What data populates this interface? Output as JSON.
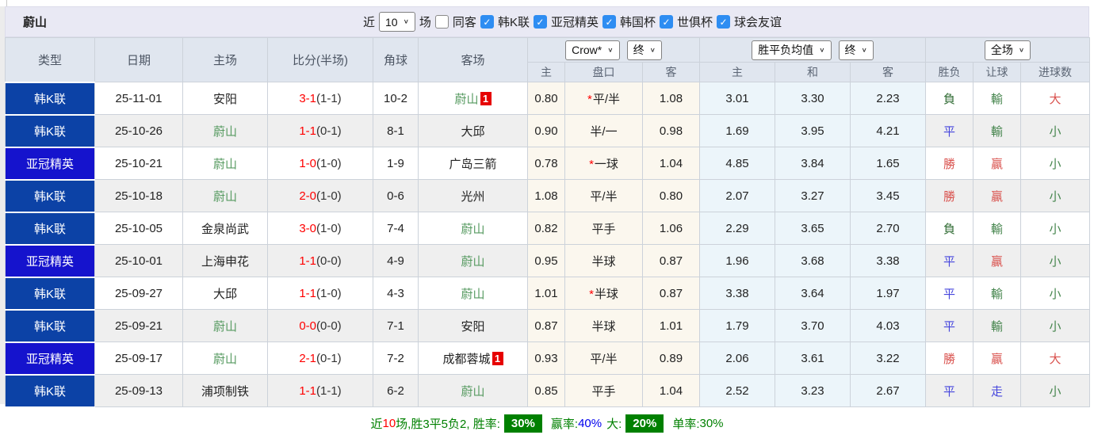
{
  "header": {
    "team": "蔚山",
    "recent_label": "近",
    "recent_count": "10",
    "matches_label": "场",
    "same_venue": {
      "label": "同客",
      "checked": false
    },
    "leagues": [
      {
        "label": "韩K联",
        "checked": true
      },
      {
        "label": "亚冠精英",
        "checked": true
      },
      {
        "label": "韩国杯",
        "checked": true
      },
      {
        "label": "世俱杯",
        "checked": true
      },
      {
        "label": "球会友谊",
        "checked": true
      }
    ]
  },
  "controls": {
    "odds_company": "Crow*",
    "odds_time": "终",
    "avg_label": "胜平负均值",
    "avg_time": "终",
    "scope": "全场"
  },
  "table": {
    "columns": [
      "类型",
      "日期",
      "主场",
      "比分(半场)",
      "角球",
      "客场"
    ],
    "sub_columns": [
      "主",
      "盘口",
      "客",
      "主",
      "和",
      "客",
      "胜负",
      "让球",
      "进球数"
    ],
    "rows": [
      {
        "league": "韩K联",
        "league_color": "#0c42a6",
        "date": "25-11-01",
        "home": "安阳",
        "home_self": false,
        "home_badge": "",
        "score_ft": "3-1",
        "score_ht": "(1-1)",
        "corner": "10-2",
        "away": "蔚山",
        "away_self": true,
        "away_badge": "1",
        "odds_home": "0.80",
        "line": "平/半",
        "line_star": true,
        "odds_away": "1.08",
        "avg_home": "3.01",
        "avg_draw": "3.30",
        "avg_away": "2.23",
        "res_wdl": {
          "t": "負",
          "c": "dgreen"
        },
        "res_handicap": {
          "t": "輸",
          "c": "green"
        },
        "res_goals": {
          "t": "大",
          "c": "red"
        }
      },
      {
        "league": "韩K联",
        "league_color": "#0c42a6",
        "date": "25-10-26",
        "home": "蔚山",
        "home_self": true,
        "home_badge": "",
        "score_ft": "1-1",
        "score_ht": "(0-1)",
        "corner": "8-1",
        "away": "大邱",
        "away_self": false,
        "away_badge": "",
        "odds_home": "0.90",
        "line": "半/一",
        "line_star": false,
        "odds_away": "0.98",
        "avg_home": "1.69",
        "avg_draw": "3.95",
        "avg_away": "4.21",
        "res_wdl": {
          "t": "平",
          "c": "blue"
        },
        "res_handicap": {
          "t": "輸",
          "c": "green"
        },
        "res_goals": {
          "t": "小",
          "c": "green"
        }
      },
      {
        "league": "亚冠精英",
        "league_color": "#1513cd",
        "date": "25-10-21",
        "home": "蔚山",
        "home_self": true,
        "home_badge": "",
        "score_ft": "1-0",
        "score_ht": "(1-0)",
        "corner": "1-9",
        "away": "广岛三箭",
        "away_self": false,
        "away_badge": "",
        "odds_home": "0.78",
        "line": "一球",
        "line_star": true,
        "odds_away": "1.04",
        "avg_home": "4.85",
        "avg_draw": "3.84",
        "avg_away": "1.65",
        "res_wdl": {
          "t": "勝",
          "c": "red"
        },
        "res_handicap": {
          "t": "贏",
          "c": "red"
        },
        "res_goals": {
          "t": "小",
          "c": "green"
        }
      },
      {
        "league": "韩K联",
        "league_color": "#0c42a6",
        "date": "25-10-18",
        "home": "蔚山",
        "home_self": true,
        "home_badge": "",
        "score_ft": "2-0",
        "score_ht": "(1-0)",
        "corner": "0-6",
        "away": "光州",
        "away_self": false,
        "away_badge": "",
        "odds_home": "1.08",
        "line": "平/半",
        "line_star": false,
        "odds_away": "0.80",
        "avg_home": "2.07",
        "avg_draw": "3.27",
        "avg_away": "3.45",
        "res_wdl": {
          "t": "勝",
          "c": "red"
        },
        "res_handicap": {
          "t": "贏",
          "c": "red"
        },
        "res_goals": {
          "t": "小",
          "c": "green"
        }
      },
      {
        "league": "韩K联",
        "league_color": "#0c42a6",
        "date": "25-10-05",
        "home": "金泉尚武",
        "home_self": false,
        "home_badge": "",
        "score_ft": "3-0",
        "score_ht": "(1-0)",
        "corner": "7-4",
        "away": "蔚山",
        "away_self": true,
        "away_badge": "",
        "odds_home": "0.82",
        "line": "平手",
        "line_star": false,
        "odds_away": "1.06",
        "avg_home": "2.29",
        "avg_draw": "3.65",
        "avg_away": "2.70",
        "res_wdl": {
          "t": "負",
          "c": "dgreen"
        },
        "res_handicap": {
          "t": "輸",
          "c": "green"
        },
        "res_goals": {
          "t": "小",
          "c": "green"
        }
      },
      {
        "league": "亚冠精英",
        "league_color": "#1513cd",
        "date": "25-10-01",
        "home": "上海申花",
        "home_self": false,
        "home_badge": "",
        "score_ft": "1-1",
        "score_ht": "(0-0)",
        "corner": "4-9",
        "away": "蔚山",
        "away_self": true,
        "away_badge": "",
        "odds_home": "0.95",
        "line": "半球",
        "line_star": false,
        "odds_away": "0.87",
        "avg_home": "1.96",
        "avg_draw": "3.68",
        "avg_away": "3.38",
        "res_wdl": {
          "t": "平",
          "c": "blue"
        },
        "res_handicap": {
          "t": "贏",
          "c": "red"
        },
        "res_goals": {
          "t": "小",
          "c": "green"
        }
      },
      {
        "league": "韩K联",
        "league_color": "#0c42a6",
        "date": "25-09-27",
        "home": "大邱",
        "home_self": false,
        "home_badge": "",
        "score_ft": "1-1",
        "score_ht": "(1-0)",
        "corner": "4-3",
        "away": "蔚山",
        "away_self": true,
        "away_badge": "",
        "odds_home": "1.01",
        "line": "半球",
        "line_star": true,
        "odds_away": "0.87",
        "avg_home": "3.38",
        "avg_draw": "3.64",
        "avg_away": "1.97",
        "res_wdl": {
          "t": "平",
          "c": "blue"
        },
        "res_handicap": {
          "t": "輸",
          "c": "green"
        },
        "res_goals": {
          "t": "小",
          "c": "green"
        }
      },
      {
        "league": "韩K联",
        "league_color": "#0c42a6",
        "date": "25-09-21",
        "home": "蔚山",
        "home_self": true,
        "home_badge": "",
        "score_ft": "0-0",
        "score_ht": "(0-0)",
        "corner": "7-1",
        "away": "安阳",
        "away_self": false,
        "away_badge": "",
        "odds_home": "0.87",
        "line": "半球",
        "line_star": false,
        "odds_away": "1.01",
        "avg_home": "1.79",
        "avg_draw": "3.70",
        "avg_away": "4.03",
        "res_wdl": {
          "t": "平",
          "c": "blue"
        },
        "res_handicap": {
          "t": "輸",
          "c": "green"
        },
        "res_goals": {
          "t": "小",
          "c": "green"
        }
      },
      {
        "league": "亚冠精英",
        "league_color": "#1513cd",
        "date": "25-09-17",
        "home": "蔚山",
        "home_self": true,
        "home_badge": "",
        "score_ft": "2-1",
        "score_ht": "(0-1)",
        "corner": "7-2",
        "away": "成都蓉城",
        "away_self": false,
        "away_badge": "1",
        "odds_home": "0.93",
        "line": "平/半",
        "line_star": false,
        "odds_away": "0.89",
        "avg_home": "2.06",
        "avg_draw": "3.61",
        "avg_away": "3.22",
        "res_wdl": {
          "t": "勝",
          "c": "red"
        },
        "res_handicap": {
          "t": "贏",
          "c": "red"
        },
        "res_goals": {
          "t": "大",
          "c": "red"
        }
      },
      {
        "league": "韩K联",
        "league_color": "#0c42a6",
        "date": "25-09-13",
        "home": "浦项制铁",
        "home_self": false,
        "home_badge": "",
        "score_ft": "1-1",
        "score_ht": "(1-1)",
        "corner": "6-2",
        "away": "蔚山",
        "away_self": true,
        "away_badge": "",
        "odds_home": "0.85",
        "line": "平手",
        "line_star": false,
        "odds_away": "1.04",
        "avg_home": "2.52",
        "avg_draw": "3.23",
        "avg_away": "2.67",
        "res_wdl": {
          "t": "平",
          "c": "blue"
        },
        "res_handicap": {
          "t": "走",
          "c": "blue"
        },
        "res_goals": {
          "t": "小",
          "c": "green"
        }
      }
    ]
  },
  "summary": {
    "prefix": "近",
    "count": "10",
    "record": "场,胜3平5负2, 胜率:",
    "win_rate": "30%",
    "handicap_label": "赢率:",
    "handicap_rate": "40%",
    "big_label": "大:",
    "big_rate": "20%",
    "single_label": "单率:",
    "single_rate": "30%"
  },
  "colors": {
    "league_kleague_bg": "#0c42a6",
    "league_acl_bg": "#1513cd",
    "self_team_green": "#569a60",
    "score_red": "#ff0000",
    "result_win_red": "#d9504c",
    "result_draw_blue": "#4646dd",
    "result_lose_dark_green": "#2f6b33",
    "result_handicap_green": "#45854d",
    "summary_green": "#008000",
    "rate_badge_bg": "#008000",
    "rate_blue": "#0000ee",
    "checkbox_blue": "#2e8df2",
    "red_card_badge": "#e60000",
    "header_bar_bg": "#e9e9f4",
    "table_header_bg": "#e0e6ef",
    "odds_col_bg": "#fbf7ee",
    "avg_col_bg": "#ecf5fa",
    "alt_row_bg": "#efefef"
  }
}
